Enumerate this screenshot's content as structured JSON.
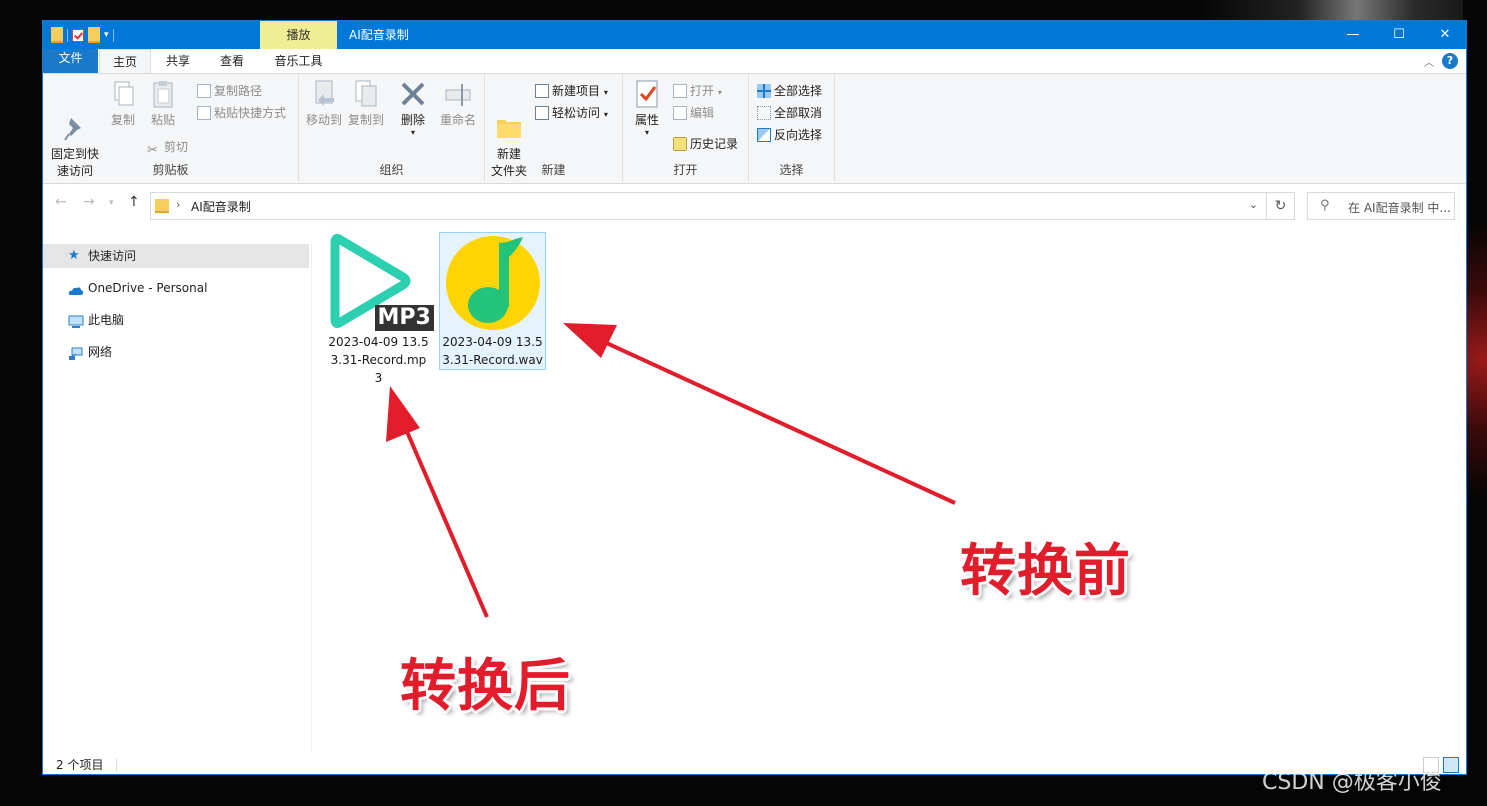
{
  "titlebar": {
    "context_tab": "播放",
    "title": "AI配音录制",
    "minimize": "—",
    "maximize": "☐",
    "close": "✕"
  },
  "tabs": [
    "文件",
    "主页",
    "共享",
    "查看",
    "音乐工具"
  ],
  "ribbon": {
    "clipboard": {
      "pin": "固定到快\n速访问",
      "copy": "复制",
      "paste": "粘贴",
      "copy_path": "复制路径",
      "paste_shortcut": "粘贴快捷方式",
      "cut": "剪切",
      "label": "剪贴板"
    },
    "organize": {
      "move_to": "移动到",
      "copy_to": "复制到",
      "delete": "删除",
      "rename": "重命名",
      "label": "组织"
    },
    "new": {
      "new_folder": "新建\n文件夹",
      "new_item": "新建项目",
      "easy_access": "轻松访问",
      "label": "新建"
    },
    "open": {
      "properties": "属性",
      "open": "打开",
      "edit": "编辑",
      "history": "历史记录",
      "label": "打开"
    },
    "select": {
      "select_all": "全部选择",
      "select_none": "全部取消",
      "invert": "反向选择",
      "label": "选择"
    }
  },
  "address": {
    "path": "AI配音录制",
    "search_placeholder": "在 AI配音录制 中..."
  },
  "nav": {
    "items": [
      {
        "label": "快速访问",
        "icon": "star-icon"
      },
      {
        "label": "OneDrive - Personal",
        "icon": "cloud-icon"
      },
      {
        "label": "此电脑",
        "icon": "computer-icon"
      },
      {
        "label": "网络",
        "icon": "network-icon"
      }
    ]
  },
  "files": [
    {
      "name": "2023-04-09 13.53.31-Record.mp3",
      "icon": "mp3-play-icon",
      "badge": "MP3"
    },
    {
      "name": "2023-04-09 13.53.31-Record.wav",
      "icon": "qq-music-icon"
    }
  ],
  "status": {
    "count": "2 个项目"
  },
  "annotations": {
    "before": "转换前",
    "after": "转换后"
  },
  "watermark": "CSDN @极客小俊",
  "colors": {
    "accent": "#0078d7",
    "context_tab": "#f0ee94",
    "annotation_red": "#e11d2b",
    "mp3_teal": "#2ccfb0",
    "qq_yellow": "#ffd400",
    "qq_green": "#22c37a"
  }
}
